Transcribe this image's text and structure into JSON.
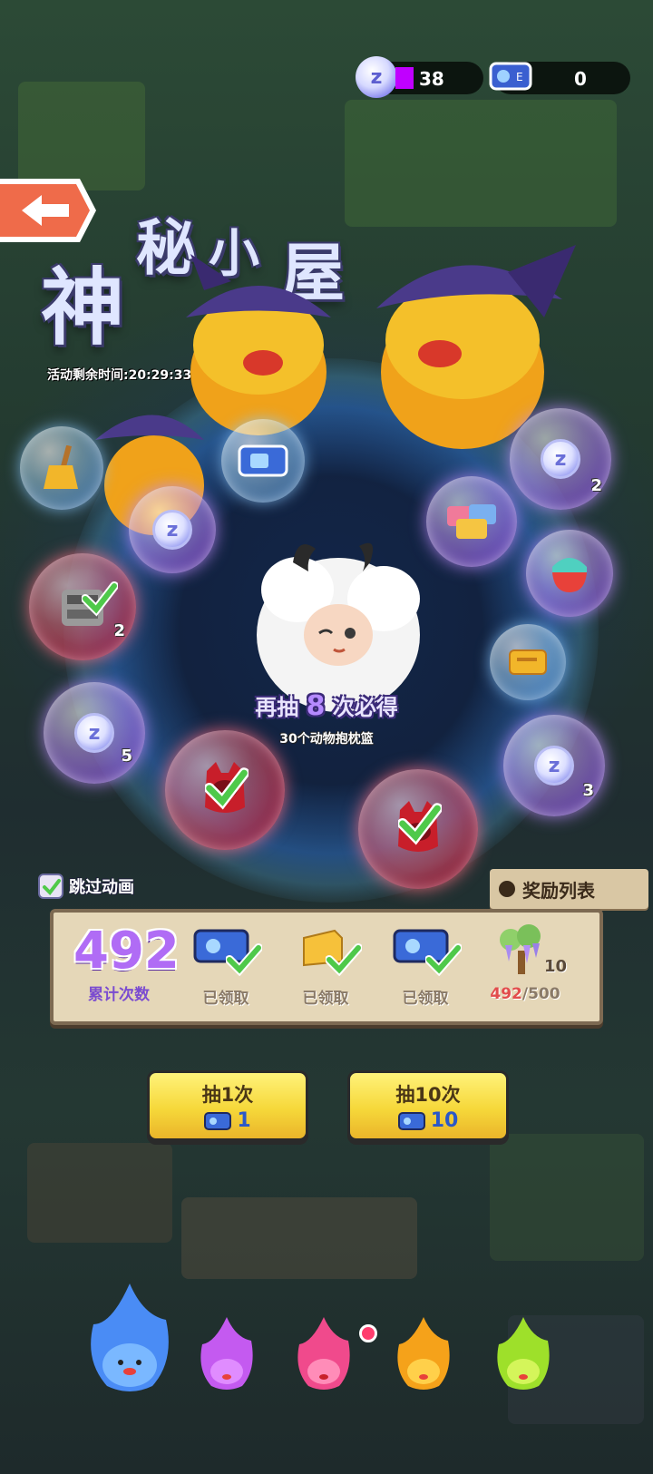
{
  "currency": {
    "coins": "38",
    "coin_icon": "z-coin-icon",
    "tickets": "0",
    "ticket_icon": "ticket-icon"
  },
  "header": {
    "title_chars": [
      "神",
      "秘",
      "小",
      "屋"
    ],
    "timer": "活动剩余时间:20:29:33"
  },
  "wheel": {
    "counts": {
      "coin_top_right": "2",
      "tech_block": "2",
      "coin_left": "5",
      "coin_right": "3"
    },
    "items": [
      "broom-icon",
      "blue-ticket-icon",
      "z-coin-icon",
      "coupon-bundle-icon",
      "cat-bowl-icon",
      "tech-block-icon",
      "gold-ticket-icon",
      "red-creature-icon"
    ]
  },
  "center": {
    "prefix": "再抽",
    "remaining": "8",
    "suffix": "次必得",
    "prize": "30个动物抱枕篮"
  },
  "controls": {
    "skip_label": "跳过动画",
    "skip_checked": true,
    "reward_list": "奖励列表"
  },
  "progress": {
    "total": "492",
    "total_label": "累计次数",
    "milestones": [
      {
        "icon": "blue-ticket-icon",
        "label": "已领取",
        "claimed": true
      },
      {
        "icon": "cheese-block-icon",
        "label": "已领取",
        "claimed": true
      },
      {
        "icon": "blue-ticket-icon",
        "label": "已领取",
        "claimed": true
      },
      {
        "icon": "wisteria-tree-icon",
        "count": "10",
        "current": "492",
        "target": "/500",
        "claimed": false
      }
    ]
  },
  "draw_buttons": [
    {
      "label": "抽1次",
      "cost": "1"
    },
    {
      "label": "抽10次",
      "cost": "10"
    }
  ],
  "colors": {
    "accent_purple": "#b06cf5",
    "button_yellow": "#f6d83a",
    "progress_red": "#e24d4d"
  }
}
